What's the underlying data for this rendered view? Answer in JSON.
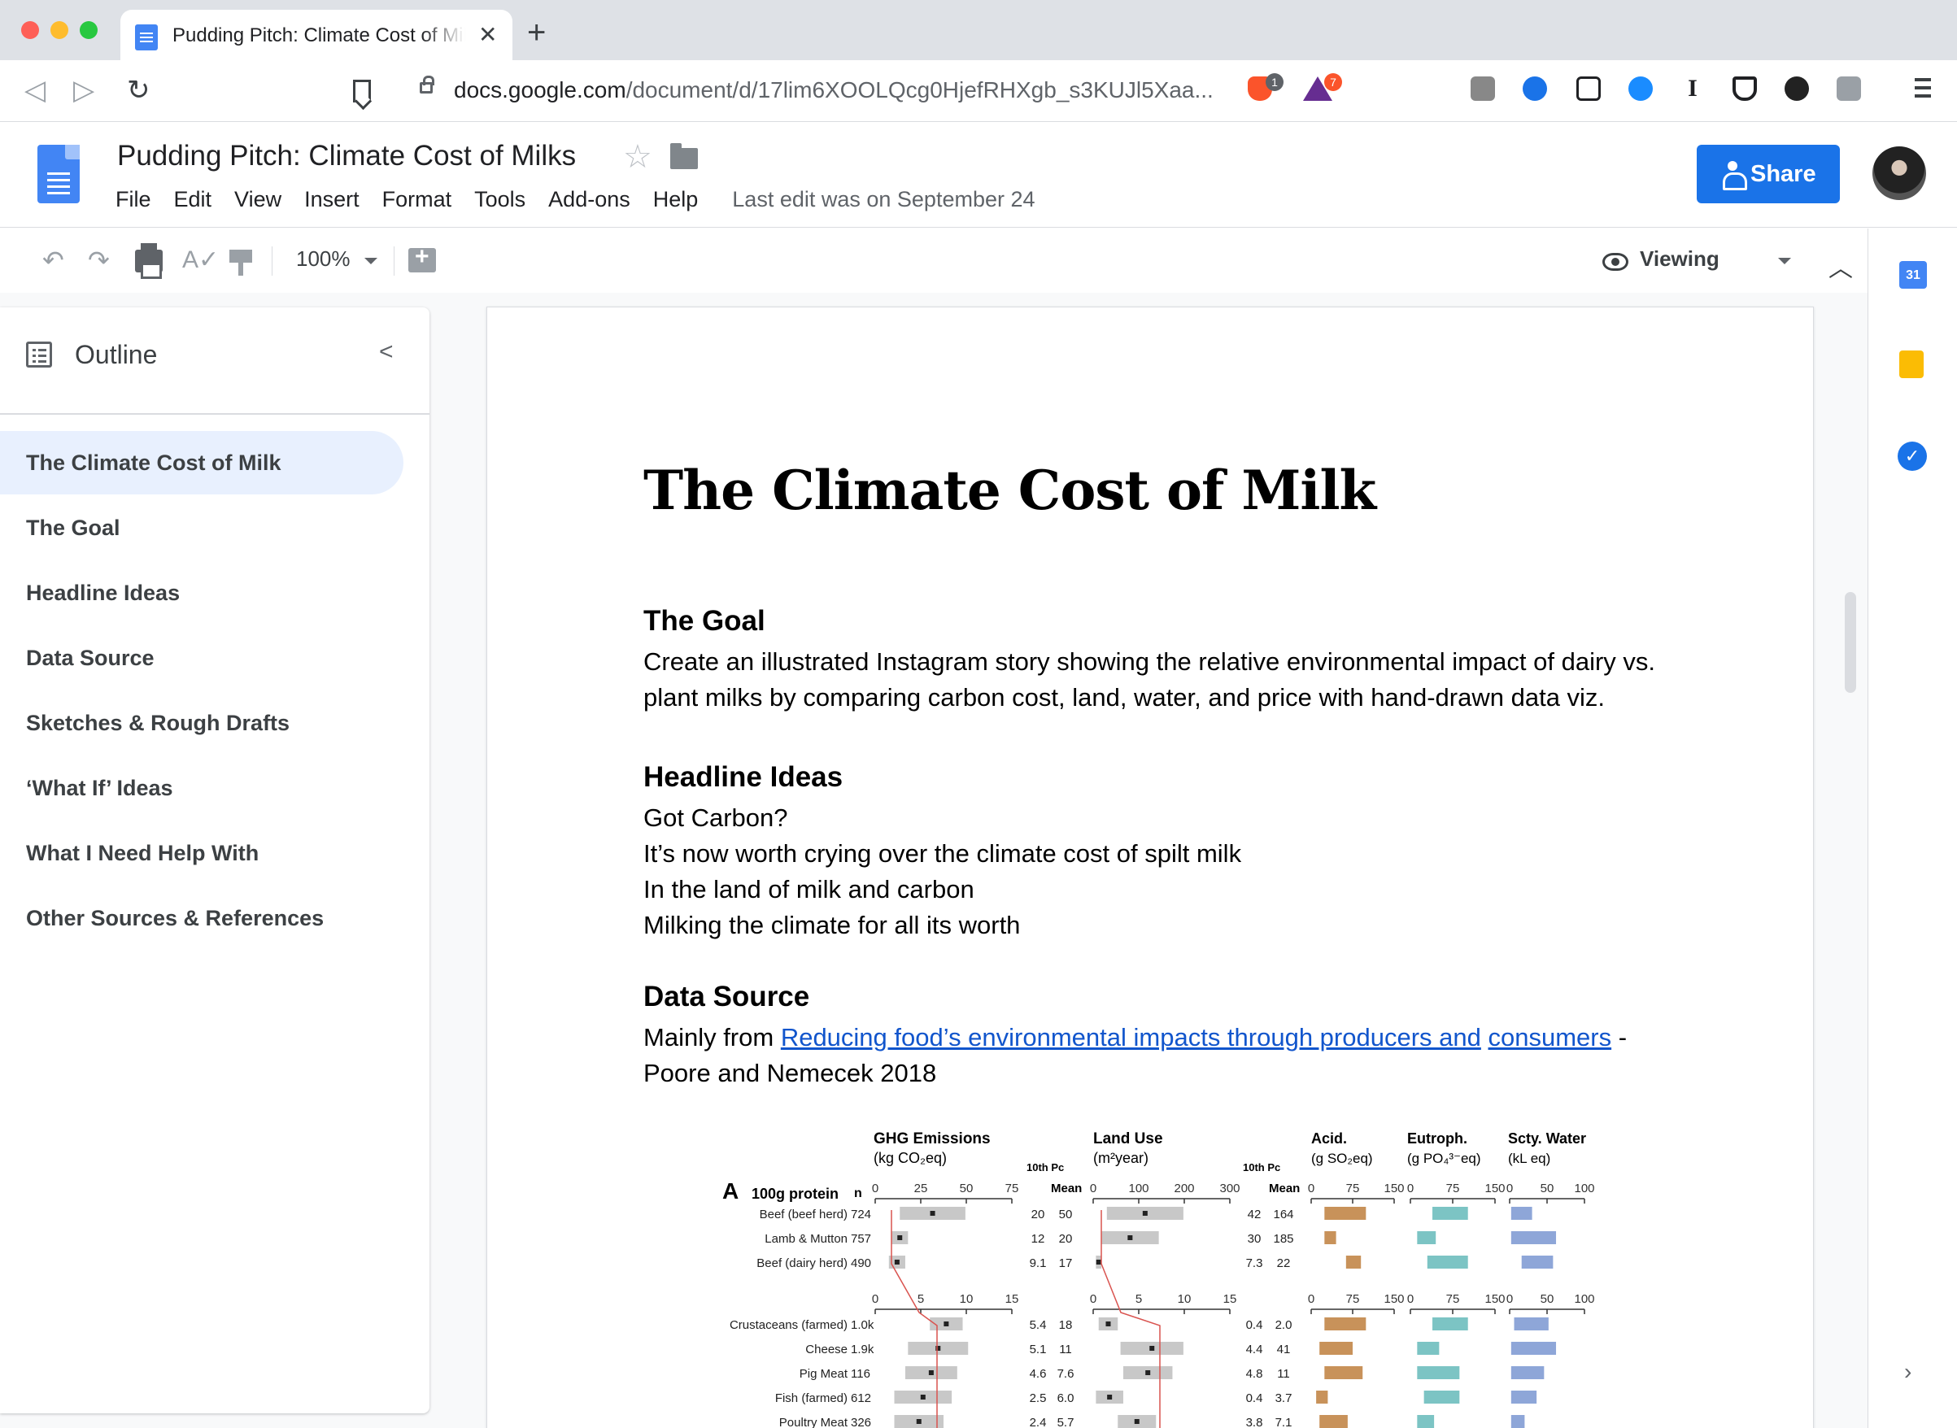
{
  "browser": {
    "tab_title": "Pudding Pitch: Climate Cost of Milks",
    "url_host": "docs.google.com",
    "url_path": "/document/d/17lim6XOOLQcg0HjefRHXgb_s3KUJl5Xaa...",
    "brave_badge": "1",
    "rewards_badge": "7"
  },
  "docs": {
    "title": "Pudding Pitch: Climate Cost of Milks",
    "menu": [
      "File",
      "Edit",
      "View",
      "Insert",
      "Format",
      "Tools",
      "Add-ons",
      "Help"
    ],
    "last_edit": "Last edit was on September 24",
    "share_label": "Share"
  },
  "toolbar": {
    "zoom": "100%",
    "mode": "Viewing"
  },
  "side_panel": {
    "calendar_label": "31"
  },
  "outline": {
    "title": "Outline",
    "items": [
      "The Climate Cost of Milk",
      "The Goal",
      "Headline Ideas",
      "Data Source",
      "Sketches & Rough Drafts",
      "‘What If’ Ideas",
      "What I Need Help With",
      "Other Sources & References"
    ]
  },
  "document": {
    "heading": "The Climate Cost of Milk",
    "goal_heading": "The Goal",
    "goal_line1": "Create an illustrated Instagram story showing the relative environmental impact of dairy vs.",
    "goal_line2": "plant milks by comparing carbon cost, land, water, and price with hand-drawn data viz.",
    "headline_heading": "Headline Ideas",
    "headlines": [
      "Got Carbon?",
      "It’s now worth crying over the climate cost of spilt milk",
      "In the land of milk and carbon",
      "Milking the climate for all its worth"
    ],
    "source_heading": "Data Source",
    "source_prefix": "Mainly from ",
    "source_link_a": "Reducing food’s environmental impacts through producers and",
    "source_link_b": "consumers",
    "source_suffix": " -",
    "source_line2": "Poore and Nemecek 2018"
  },
  "figure": {
    "panel_label": "A",
    "row_header": "100g protein",
    "n_header": "n",
    "ghg_title": "GHG Emissions",
    "ghg_unit": "(kg CO₂eq)",
    "land_title": "Land Use",
    "land_unit": "(m²year)",
    "acid_title": "Acid.",
    "acid_unit": "(g SO₂eq)",
    "eutro_title": "Eutroph.",
    "eutro_unit": "(g PO₄³⁻eq)",
    "water_title": "Scty. Water",
    "water_unit": "(kL eq)",
    "pc_header": "10th Pc",
    "mean_header": "Mean",
    "ghg_ticks_top": [
      "0",
      "25",
      "50",
      "75"
    ],
    "ghg_ticks_bottom": [
      "0",
      "5",
      "10",
      "15"
    ],
    "land_ticks_top": [
      "0",
      "100",
      "200",
      "300"
    ],
    "land_ticks_bottom": [
      "0",
      "5",
      "10",
      "15"
    ],
    "acid_ticks": [
      "0",
      "75",
      "150"
    ],
    "eutro_ticks": [
      "0",
      "75",
      "150"
    ],
    "water_ticks": [
      "0",
      "50",
      "100"
    ],
    "rows": [
      {
        "name": "Beef (beef herd)",
        "n": "724",
        "ghg_pc": "20",
        "ghg_mean": "50",
        "land_pc": "42",
        "land_mean": "164"
      },
      {
        "name": "Lamb & Mutton",
        "n": "757",
        "ghg_pc": "12",
        "ghg_mean": "20",
        "land_pc": "30",
        "land_mean": "185"
      },
      {
        "name": "Beef (dairy herd)",
        "n": "490",
        "ghg_pc": "9.1",
        "ghg_mean": "17",
        "land_pc": "7.3",
        "land_mean": "22"
      },
      {
        "name": "Crustaceans (farmed)",
        "n": "1.0k",
        "ghg_pc": "5.4",
        "ghg_mean": "18",
        "land_pc": "0.4",
        "land_mean": "2.0"
      },
      {
        "name": "Cheese",
        "n": "1.9k",
        "ghg_pc": "5.1",
        "ghg_mean": "11",
        "land_pc": "4.4",
        "land_mean": "41"
      },
      {
        "name": "Pig Meat",
        "n": "116",
        "ghg_pc": "4.6",
        "ghg_mean": "7.6",
        "land_pc": "4.8",
        "land_mean": "11"
      },
      {
        "name": "Fish (farmed)",
        "n": "612",
        "ghg_pc": "2.5",
        "ghg_mean": "6.0",
        "land_pc": "0.4",
        "land_mean": "3.7"
      },
      {
        "name": "Poultry Meat",
        "n": "326",
        "ghg_pc": "2.4",
        "ghg_mean": "5.7",
        "land_pc": "3.8",
        "land_mean": "7.1"
      }
    ]
  }
}
